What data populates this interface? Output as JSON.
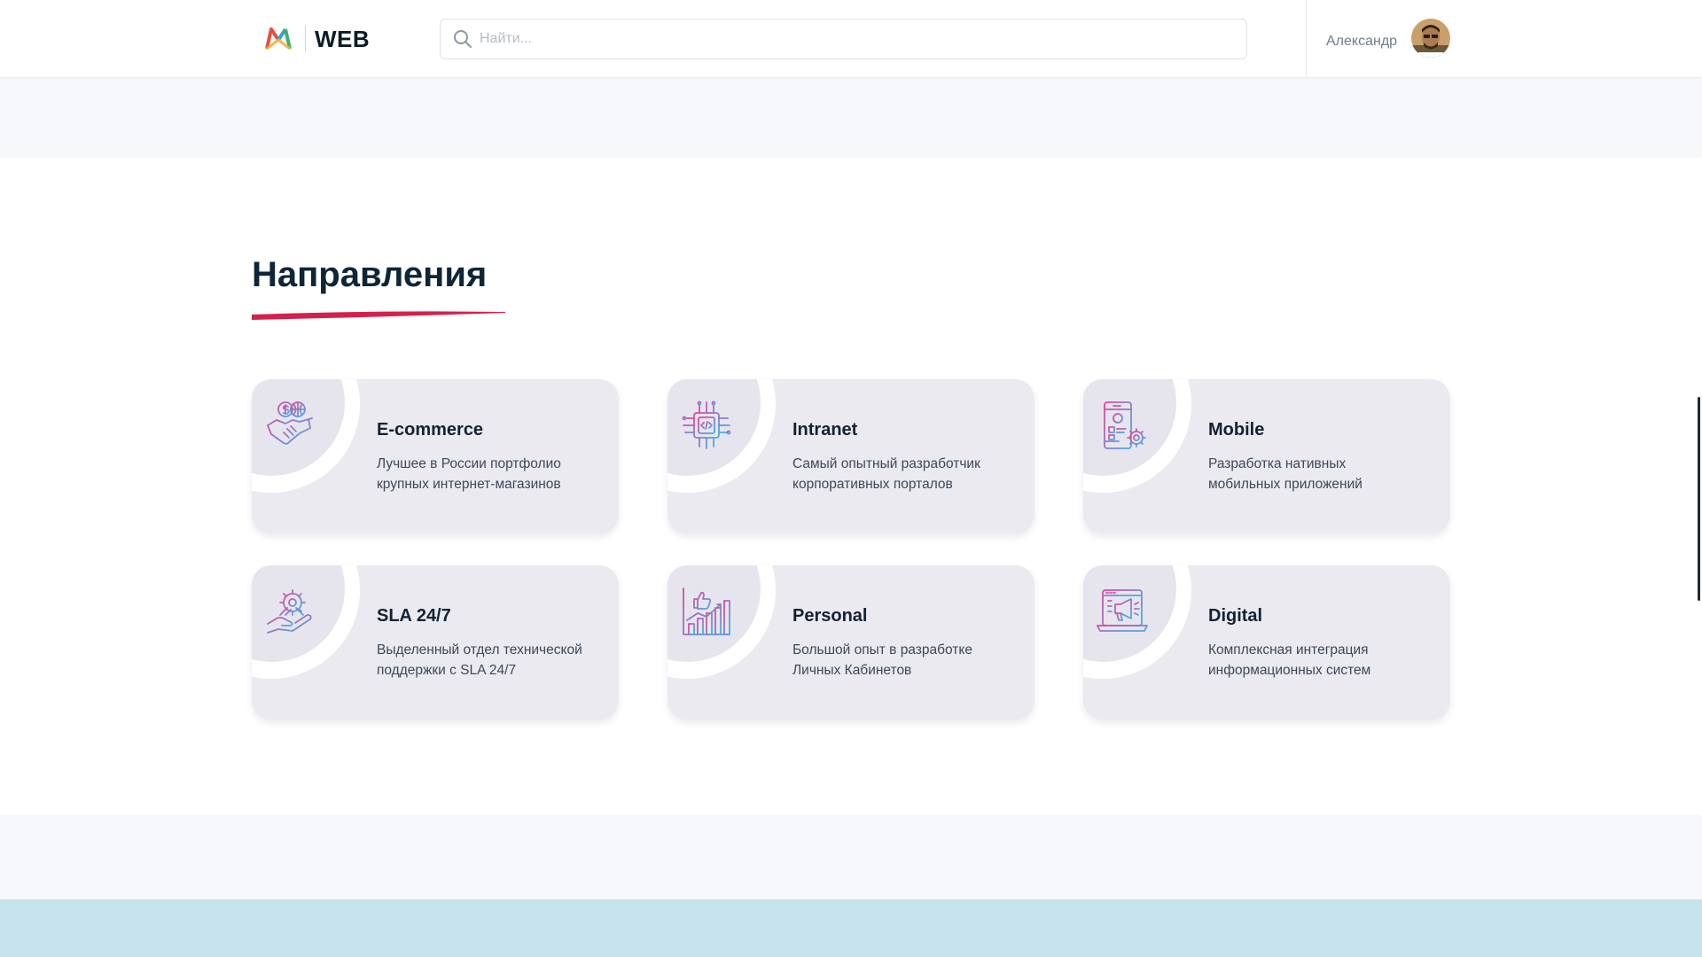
{
  "header": {
    "logo_text": "WEB",
    "search_placeholder": "Найти...",
    "search_value": "",
    "user_name": "Александр"
  },
  "section": {
    "title": "Направления"
  },
  "cards": [
    {
      "title": "E-commerce",
      "line1": "Лучшее в России портфолио",
      "line2": "крупных интернет-магазинов",
      "icon": "handshake-icon"
    },
    {
      "title": "Intranet",
      "line1": "Самый опытный разработчик",
      "line2": "корпоративных порталов",
      "icon": "chip-icon"
    },
    {
      "title": "Mobile",
      "line1": "Разработка нативных",
      "line2": "мобильных приложений",
      "icon": "mobile-settings-icon"
    },
    {
      "title": "SLA 24/7",
      "line1": "Выделенный отдел технической",
      "line2": "поддержки с SLA 24/7",
      "icon": "gear-hand-icon"
    },
    {
      "title": "Personal",
      "line1": "Большой опыт в разработке",
      "line2": "Личных Кабинетов",
      "icon": "growth-chart-icon"
    },
    {
      "title": "Digital",
      "line1": "Комплексная интеграция",
      "line2": "информационных систем",
      "icon": "laptop-megaphone-icon"
    }
  ],
  "colors": {
    "accent": "#d4204f",
    "icon_gradient_start": "#e5459a",
    "icon_gradient_end": "#3fb3ea",
    "card_bg": "#ebeaf1",
    "footer_band": "#c7e3ee"
  }
}
